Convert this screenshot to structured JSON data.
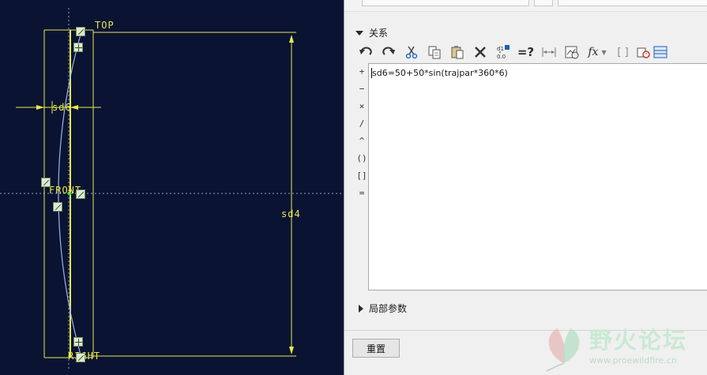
{
  "sketch": {
    "labels": {
      "top": "TOP",
      "front": "FRONT",
      "right": "RIGHT",
      "dim_sd6": "sd6",
      "dim_sd4": "sd4"
    },
    "colors": {
      "background": "#0a1332",
      "geometry": "#e8e84a",
      "curve": "#9db4e8",
      "centerline": "#8fa0c8",
      "point": "#3bd64a"
    }
  },
  "panel": {
    "relations_section_label": "关系",
    "local_params_section_label": "局部参数",
    "relation_text": "sd6=50+50*sin(trajpar*360*6)",
    "reset_button_label": "重置",
    "toolbar": [
      {
        "name": "undo-icon"
      },
      {
        "name": "redo-icon"
      },
      {
        "name": "cut-icon"
      },
      {
        "name": "copy-icon"
      },
      {
        "name": "paste-icon"
      },
      {
        "name": "delete-icon"
      },
      {
        "name": "sort-relations-icon"
      },
      {
        "name": "verify-relations-icon",
        "text": "=?"
      },
      {
        "name": "dimension-icon"
      },
      {
        "name": "evaluate-icon"
      },
      {
        "name": "function-icon",
        "text": "fx"
      },
      {
        "name": "brackets-icon",
        "text": "[ ]"
      },
      {
        "name": "units-icon"
      },
      {
        "name": "table-icon"
      }
    ],
    "operators": [
      "+",
      "−",
      "×",
      "/",
      "^",
      "()",
      "[]",
      "="
    ]
  },
  "watermark": {
    "title": "野火论坛",
    "url": "www.proewildfire.cn"
  }
}
